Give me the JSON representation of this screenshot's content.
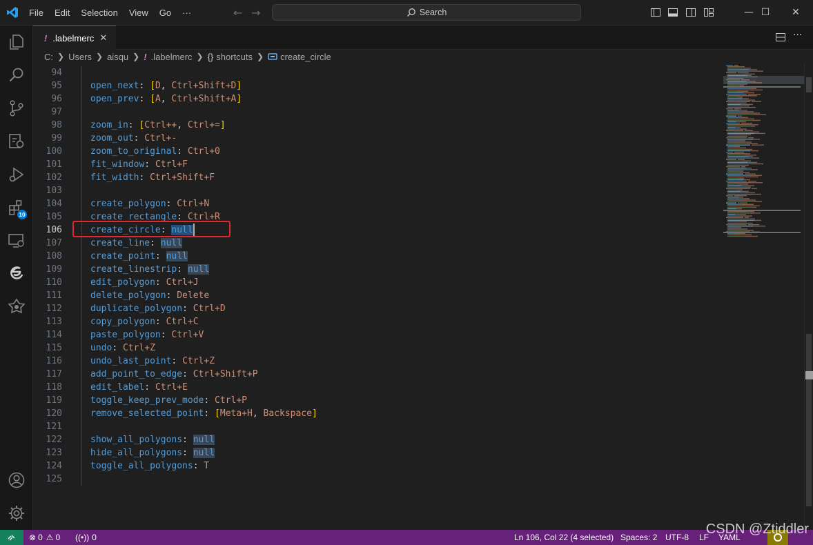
{
  "menu": [
    "File",
    "Edit",
    "Selection",
    "View",
    "Go",
    "···"
  ],
  "search": {
    "label": "Search"
  },
  "window_controls": {
    "minimize": "—",
    "maximize": "☐",
    "close": "✕"
  },
  "activity_badge": "10",
  "tab": {
    "excl": "!",
    "label": ".labelmerc",
    "close": "✕"
  },
  "breadcrumb": {
    "items": [
      "C:",
      "Users",
      "aisqu",
      ".labelmerc",
      "shortcuts",
      "create_circle"
    ],
    "excl": "!",
    "braces": "{}"
  },
  "code_lines": [
    {
      "n": "94",
      "key": "",
      "val": ""
    },
    {
      "n": "95",
      "key": "open_next",
      "val": "[D, Ctrl+Shift+D]"
    },
    {
      "n": "96",
      "key": "open_prev",
      "val": "[A, Ctrl+Shift+A]"
    },
    {
      "n": "97",
      "key": "",
      "val": ""
    },
    {
      "n": "98",
      "key": "zoom_in",
      "val": "[Ctrl++, Ctrl+=]"
    },
    {
      "n": "99",
      "key": "zoom_out",
      "val": "Ctrl+-"
    },
    {
      "n": "100",
      "key": "zoom_to_original",
      "val": "Ctrl+0"
    },
    {
      "n": "101",
      "key": "fit_window",
      "val": "Ctrl+F"
    },
    {
      "n": "102",
      "key": "fit_width",
      "val": "Ctrl+Shift+F"
    },
    {
      "n": "103",
      "key": "",
      "val": ""
    },
    {
      "n": "104",
      "key": "create_polygon",
      "val": "Ctrl+N"
    },
    {
      "n": "105",
      "key": "create_rectangle",
      "val": "Ctrl+R"
    },
    {
      "n": "106",
      "key": "create_circle",
      "val": "null"
    },
    {
      "n": "107",
      "key": "create_line",
      "val": "null"
    },
    {
      "n": "108",
      "key": "create_point",
      "val": "null"
    },
    {
      "n": "109",
      "key": "create_linestrip",
      "val": "null"
    },
    {
      "n": "110",
      "key": "edit_polygon",
      "val": "Ctrl+J"
    },
    {
      "n": "111",
      "key": "delete_polygon",
      "val": "Delete"
    },
    {
      "n": "112",
      "key": "duplicate_polygon",
      "val": "Ctrl+D"
    },
    {
      "n": "113",
      "key": "copy_polygon",
      "val": "Ctrl+C"
    },
    {
      "n": "114",
      "key": "paste_polygon",
      "val": "Ctrl+V"
    },
    {
      "n": "115",
      "key": "undo",
      "val": "Ctrl+Z"
    },
    {
      "n": "116",
      "key": "undo_last_point",
      "val": "Ctrl+Z"
    },
    {
      "n": "117",
      "key": "add_point_to_edge",
      "val": "Ctrl+Shift+P"
    },
    {
      "n": "118",
      "key": "edit_label",
      "val": "Ctrl+E"
    },
    {
      "n": "119",
      "key": "toggle_keep_prev_mode",
      "val": "Ctrl+P"
    },
    {
      "n": "120",
      "key": "remove_selected_point",
      "val": "[Meta+H, Backspace]"
    },
    {
      "n": "121",
      "key": "",
      "val": ""
    },
    {
      "n": "122",
      "key": "show_all_polygons",
      "val": "null"
    },
    {
      "n": "123",
      "key": "hide_all_polygons",
      "val": "null"
    },
    {
      "n": "124",
      "key": "toggle_all_polygons",
      "val": "T"
    },
    {
      "n": "125",
      "key": "",
      "val": ""
    }
  ],
  "active_line": "106",
  "status": {
    "errors": "0",
    "warnings": "0",
    "ports": "0",
    "position": "Ln 106, Col 22 (4 selected)",
    "indent": "Spaces: 2",
    "encoding": "UTF-8",
    "eol": "LF",
    "language": "YAML"
  },
  "watermark": "CSDN @Ztiddler",
  "colors": {
    "status_bar": "#68217a",
    "remote": "#16825d",
    "accent": "#0078d4",
    "highlight": "#e0282e"
  }
}
